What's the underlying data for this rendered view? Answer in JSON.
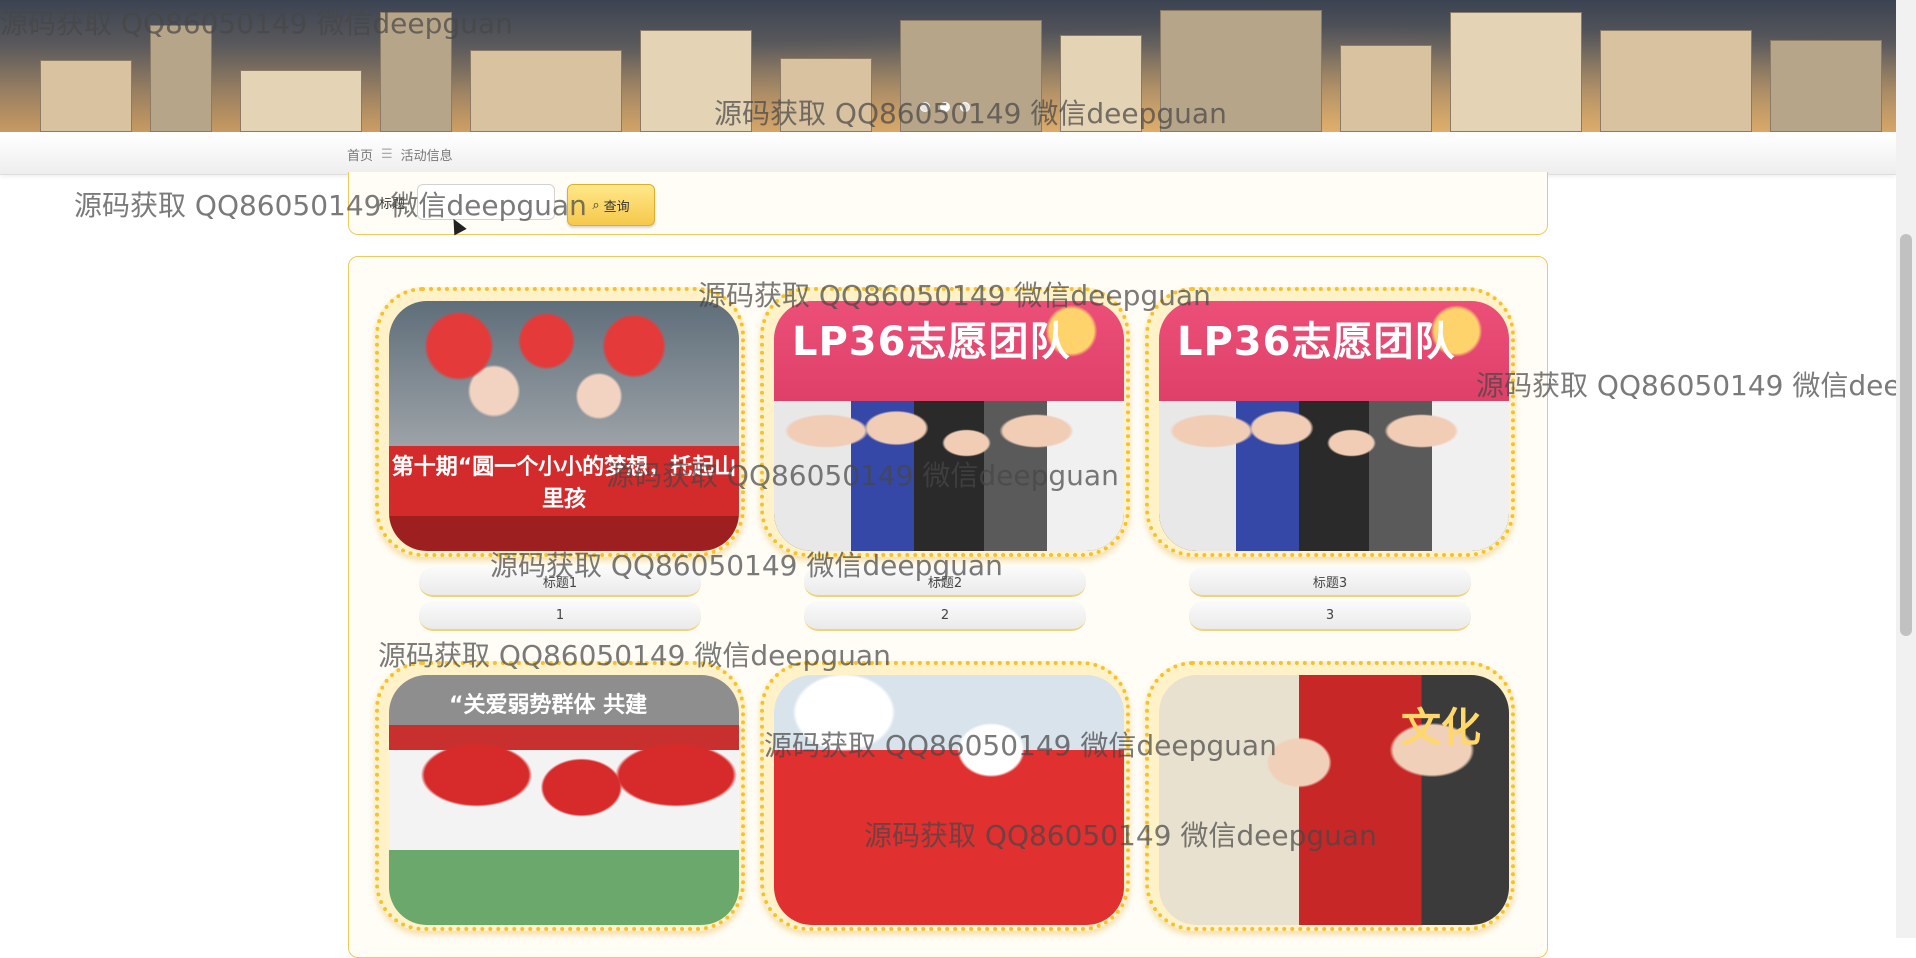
{
  "carousel": {
    "slides": 3,
    "active_index": 1
  },
  "breadcrumb": {
    "home": "首页",
    "separator": "☰",
    "current": "活动信息"
  },
  "search": {
    "label": "标题",
    "input_value": "",
    "button_label": "查询",
    "button_icon": "search-icon"
  },
  "cards": [
    {
      "title": "标题1",
      "number": "1",
      "photo_text": "第十期“圆一个小小的梦想，托起山里孩"
    },
    {
      "title": "标题2",
      "number": "2",
      "photo_text": "LP36志愿团队"
    },
    {
      "title": "标题3",
      "number": "3",
      "photo_text": "LP36志愿团队"
    },
    {
      "title": "",
      "number": "",
      "photo_text": "“关爱弱势群体 共建"
    },
    {
      "title": "",
      "number": "",
      "photo_text": ""
    },
    {
      "title": "",
      "number": "",
      "photo_text": "文化"
    }
  ],
  "watermark": "源码获取 QQ86050149 微信deepguan",
  "colors": {
    "accent_border": "#f2c85a",
    "frame_dots": "#f4c230",
    "button": "#f6c84b"
  }
}
